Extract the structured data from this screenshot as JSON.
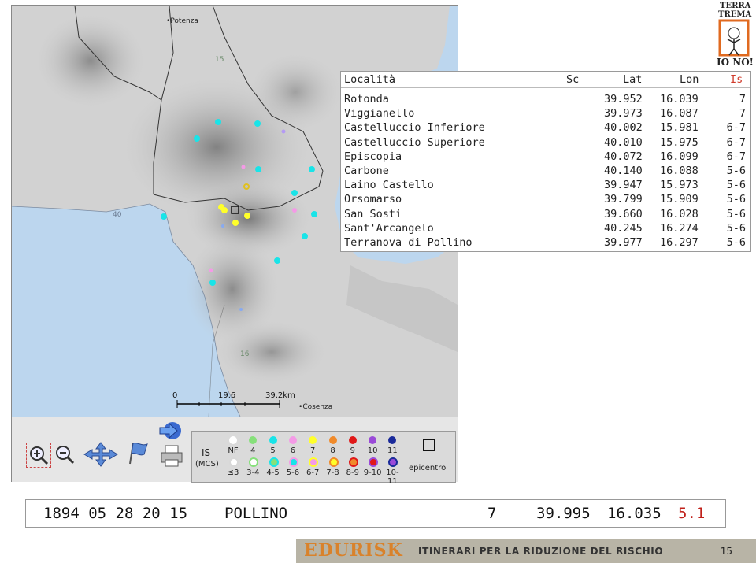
{
  "map": {
    "towns": [
      "Potenza",
      "Cosenza"
    ],
    "sea_label": "40",
    "contour_labels": [
      "15",
      "16"
    ],
    "scale_bar": [
      "0",
      "19.6",
      "39.2km"
    ]
  },
  "legend": {
    "is_label": "IS",
    "mcs_label": "(MCS)",
    "top_labels": [
      "NF",
      "4",
      "5",
      "6",
      "7",
      "8",
      "9",
      "10",
      "11"
    ],
    "bottom_labels": [
      "≤3",
      "3-4",
      "4-5",
      "5-6",
      "6-7",
      "7-8",
      "8-9",
      "9-10",
      "10-11"
    ],
    "top_colors": [
      "#ffffff",
      "#86e07a",
      "#19e4e8",
      "#f49ae6",
      "#ffff2a",
      "#f08a2a",
      "#e01818",
      "#9a4ad8",
      "#1a2a9a"
    ],
    "epicentro_label": "epicentro"
  },
  "table": {
    "headers": {
      "localita": "Località",
      "sc": "Sc",
      "lat": "Lat",
      "lon": "Lon",
      "is": "Is"
    },
    "rows": [
      {
        "localita": "Rotonda",
        "lat": "39.952",
        "lon": "16.039",
        "is": "7"
      },
      {
        "localita": "Viggianello",
        "lat": "39.973",
        "lon": "16.087",
        "is": "7"
      },
      {
        "localita": "Castelluccio Inferiore",
        "lat": "40.002",
        "lon": "15.981",
        "is": "6-7"
      },
      {
        "localita": "Castelluccio Superiore",
        "lat": "40.010",
        "lon": "15.975",
        "is": "6-7"
      },
      {
        "localita": "Episcopia",
        "lat": "40.072",
        "lon": "16.099",
        "is": "6-7"
      },
      {
        "localita": "Carbone",
        "lat": "40.140",
        "lon": "16.088",
        "is": "5-6"
      },
      {
        "localita": "Laino Castello",
        "lat": "39.947",
        "lon": "15.973",
        "is": "5-6"
      },
      {
        "localita": "Orsomarso",
        "lat": "39.799",
        "lon": "15.909",
        "is": "5-6"
      },
      {
        "localita": "San Sosti",
        "lat": "39.660",
        "lon": "16.028",
        "is": "5-6"
      },
      {
        "localita": "Sant'Arcangelo",
        "lat": "40.245",
        "lon": "16.274",
        "is": "5-6"
      },
      {
        "localita": "Terranova di Pollino",
        "lat": "39.977",
        "lon": "16.297",
        "is": "5-6"
      }
    ]
  },
  "event": {
    "date": "1894 05 28 20 15",
    "name": "POLLINO",
    "intensity": "7",
    "lat": "39.995",
    "lon": "16.035",
    "magnitude": "5.1"
  },
  "footer": {
    "brand": "EDURISK",
    "subtitle": "ITINERARI PER LA RIDUZIONE DEL RISCHIO",
    "page": "15"
  },
  "logo": {
    "line1": "TERRA",
    "line2": "TREMA",
    "line3": "IO NO!"
  },
  "colors": {
    "sea": "#bcd6ee",
    "epicenter_box": "#111111",
    "magnitude": "#c0201a",
    "is_header": "#d03a2a"
  }
}
